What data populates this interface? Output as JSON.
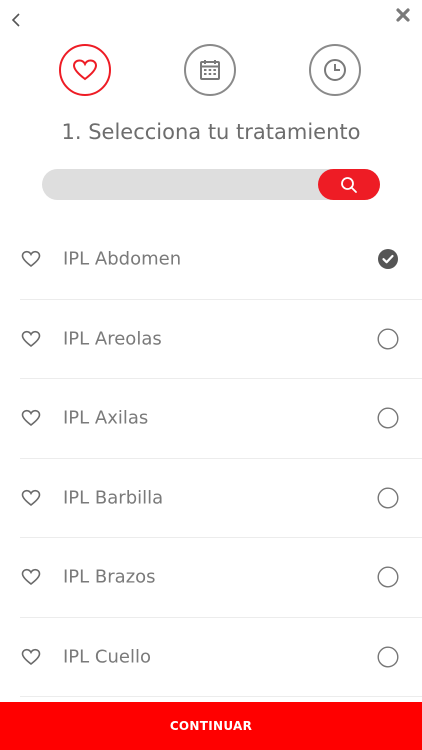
{
  "heading": "1. Selecciona tu tratamiento",
  "search": {
    "placeholder": "",
    "value": ""
  },
  "colors": {
    "accent": "#ee1c25",
    "cta": "#ff0000",
    "inactive": "#8a8a8a"
  },
  "steps": [
    {
      "icon": "heart-icon",
      "active": true
    },
    {
      "icon": "calendar-icon",
      "active": false
    },
    {
      "icon": "clock-icon",
      "active": false
    }
  ],
  "treatments": [
    {
      "label": "IPL Abdomen",
      "selected": true
    },
    {
      "label": "IPL Areolas",
      "selected": false
    },
    {
      "label": "IPL Axilas",
      "selected": false
    },
    {
      "label": "IPL Barbilla",
      "selected": false
    },
    {
      "label": "IPL Brazos",
      "selected": false
    },
    {
      "label": "IPL Cuello",
      "selected": false
    }
  ],
  "cta_label": "CONTINUAR"
}
